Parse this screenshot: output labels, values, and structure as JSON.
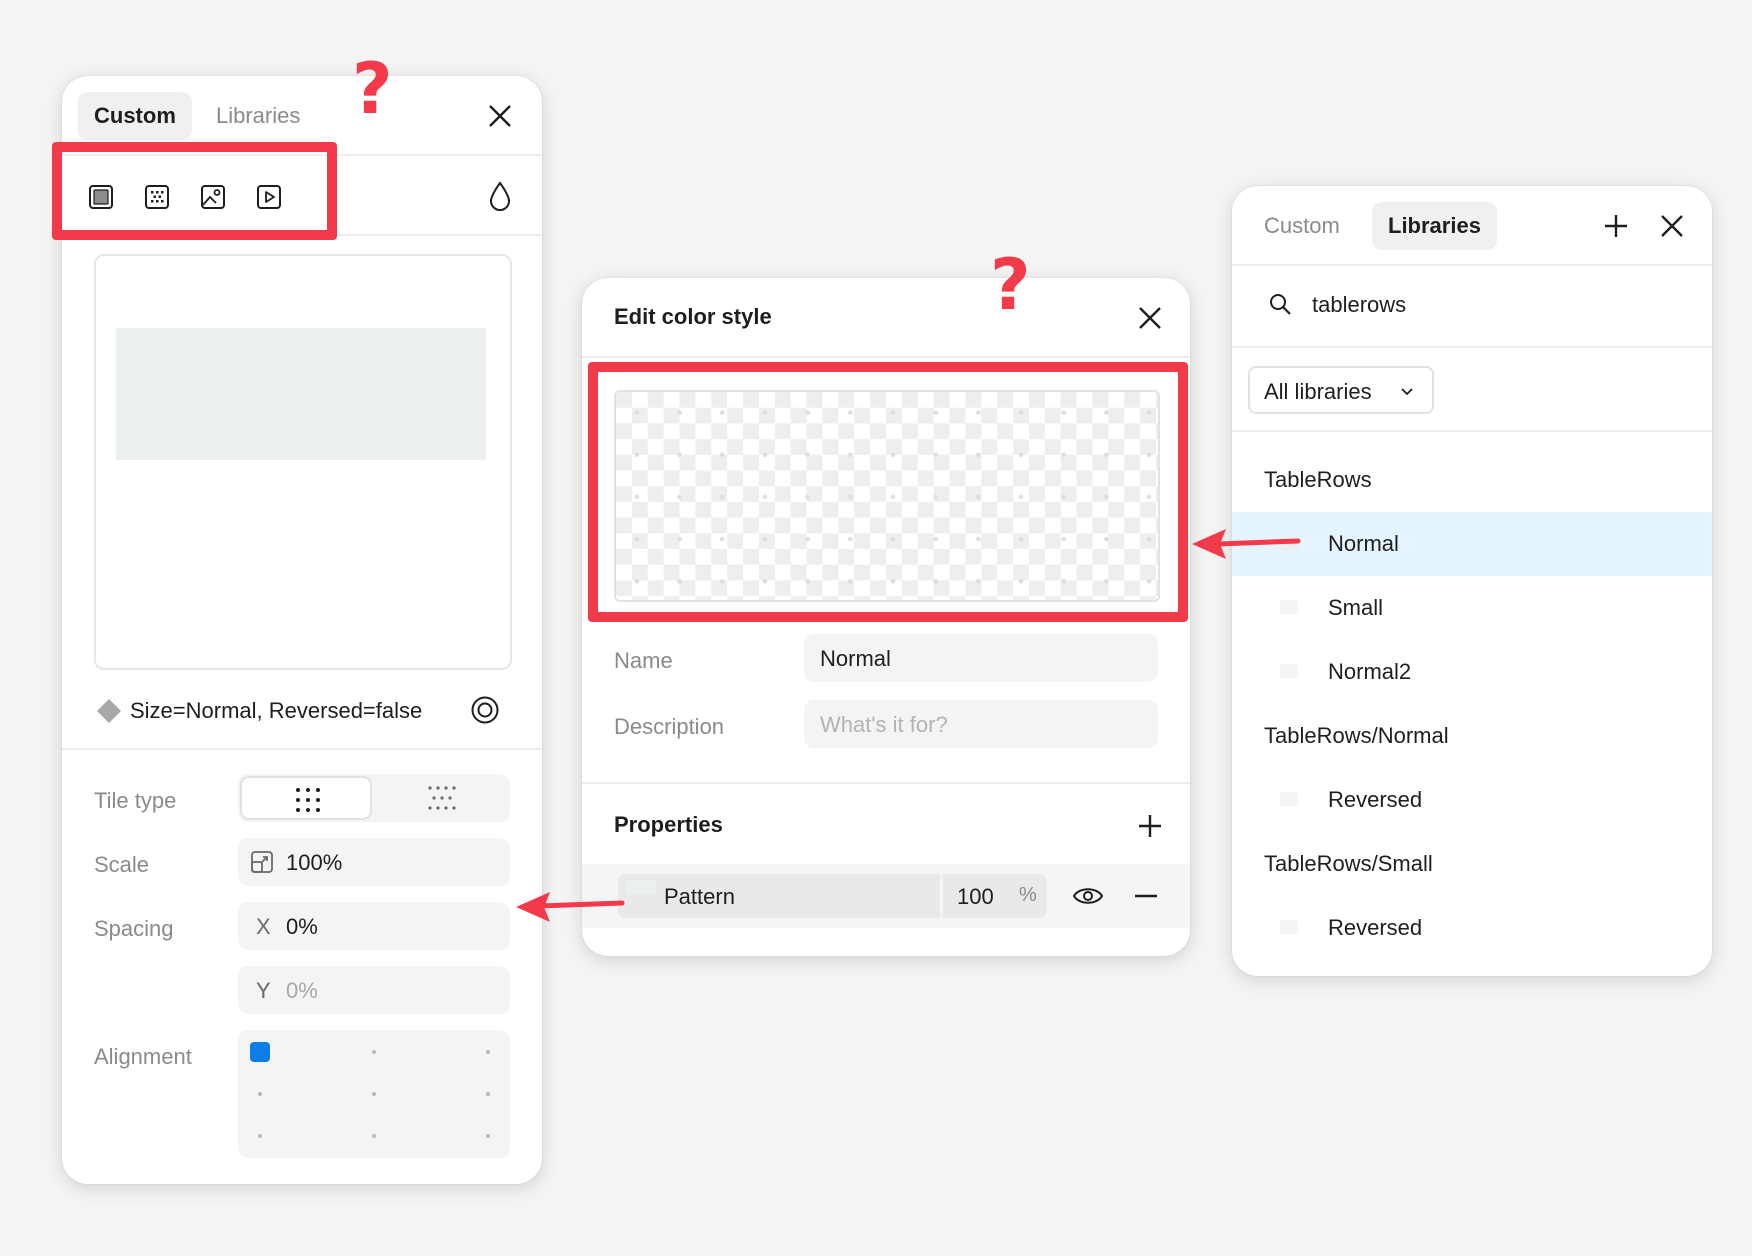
{
  "left_panel": {
    "tabs": [
      "Custom",
      "Libraries"
    ],
    "component_label": "Size=Normal, Reversed=false",
    "tile_type_label": "Tile type",
    "scale_label": "Scale",
    "scale_value": "100%",
    "spacing_label": "Spacing",
    "spacing_x_prefix": "X",
    "spacing_x_value": "0%",
    "spacing_y_prefix": "Y",
    "spacing_y_value": "0%",
    "alignment_label": "Alignment",
    "icons": [
      "solid-fill-icon",
      "pattern-fill-icon",
      "image-fill-icon",
      "video-fill-icon",
      "drop-icon",
      "close-icon",
      "target-icon",
      "scale-icon"
    ],
    "colors": {
      "preview_fill": "#ebf0ef",
      "alignment_selected": "#0d7ee8"
    }
  },
  "middle_panel": {
    "title": "Edit color style",
    "name_label": "Name",
    "name_value": "Normal",
    "description_label": "Description",
    "description_placeholder": "What's it for?",
    "properties_label": "Properties",
    "fill_name": "Pattern",
    "fill_opacity": "100",
    "fill_opacity_unit": "%",
    "icons": [
      "close-icon",
      "add-icon",
      "eye-icon",
      "minus-icon"
    ]
  },
  "right_panel": {
    "tabs": [
      "Custom",
      "Libraries"
    ],
    "search_value": "tablerows",
    "library_filter": "All libraries",
    "groups": [
      {
        "name": "TableRows",
        "items": [
          "Normal",
          "Small",
          "Normal2"
        ]
      },
      {
        "name": "TableRows/Normal",
        "items": [
          "Reversed"
        ]
      },
      {
        "name": "TableRows/Small",
        "items": [
          "Reversed"
        ]
      }
    ],
    "selected_item": "Normal",
    "colors": {
      "selected_bg": "#e5f4ff"
    }
  },
  "annotations": {
    "question_mark": "?",
    "colors": {
      "highlight": "#f23a4b"
    }
  }
}
